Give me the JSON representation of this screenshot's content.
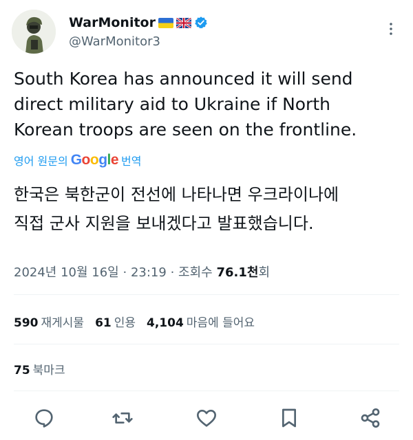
{
  "author": {
    "name": "WarMonitor",
    "handle": "@WarMonitor3",
    "flags": [
      "ukraine-flag",
      "uk-flag"
    ],
    "verified_color": "#1d9bf0"
  },
  "tweet": {
    "text_line1": "South Korea has announced it will send",
    "text_line2": "direct military aid to Ukraine if North",
    "text_line3": "Korean troops are seen on the frontline.",
    "translate_prefix": "영어 원문의",
    "translate_brand": "Google",
    "translate_suffix": "번역",
    "translated_line1": "한국은 북한군이 전선에 나타나면 우크라이나에",
    "translated_line2": "직접 군사 지원을 보내겠다고 발표했습니다."
  },
  "meta": {
    "date": "2024년 10월 16일",
    "sep1": "·",
    "time": "23:19",
    "sep2": "·",
    "views_label": "조회수",
    "views_value": "76.1천",
    "views_unit": "회"
  },
  "stats": {
    "reposts_count": "590",
    "reposts_label": "재게시물",
    "quotes_count": "61",
    "quotes_label": "인용",
    "likes_count": "4,104",
    "likes_label": "마음에 들어요",
    "bookmarks_count": "75",
    "bookmarks_label": "북마크"
  },
  "colors": {
    "text": "#0f1419",
    "secondary": "#536471",
    "accent": "#1d9bf0",
    "divider": "#eff3f4"
  },
  "icons": [
    "reply-icon",
    "retweet-icon",
    "like-icon",
    "bookmark-icon",
    "share-icon",
    "more-icon"
  ]
}
